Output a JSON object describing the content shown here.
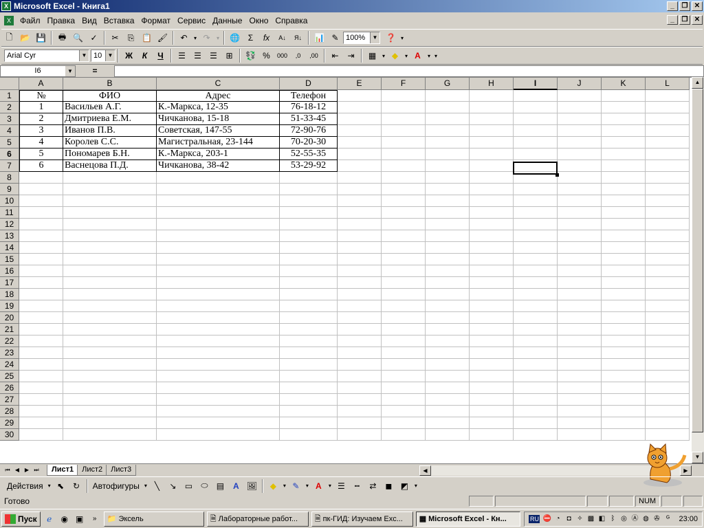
{
  "window": {
    "title": "Microsoft Excel - Книга1",
    "app_icon": "X"
  },
  "menu": [
    "Файл",
    "Правка",
    "Вид",
    "Вставка",
    "Формат",
    "Сервис",
    "Данные",
    "Окно",
    "Справка"
  ],
  "toolbar": {
    "zoom": "100%",
    "font_name": "Arial Cyr",
    "font_size": "10",
    "bold": "Ж",
    "italic": "К",
    "underline": "Ч"
  },
  "formula": {
    "name_box": "I6",
    "equals": "=",
    "value": ""
  },
  "columns": [
    "A",
    "B",
    "C",
    "D",
    "E",
    "F",
    "G",
    "H",
    "I",
    "J",
    "K",
    "L"
  ],
  "rows": [
    "1",
    "2",
    "3",
    "4",
    "5",
    "6",
    "7",
    "8",
    "9",
    "10",
    "11",
    "12",
    "13",
    "14",
    "15",
    "16",
    "17",
    "18",
    "19",
    "20",
    "21",
    "22",
    "23",
    "24",
    "25",
    "26",
    "27",
    "28",
    "29",
    "30"
  ],
  "table": {
    "headers": [
      "№",
      "ФИО",
      "Адрес",
      "Телефон"
    ],
    "data": [
      [
        "1",
        "Васильев А.Г.",
        "К.-Маркса, 12-35",
        "76-18-12"
      ],
      [
        "2",
        "Дмитриева Е.М.",
        "Чичканова, 15-18",
        "51-33-45"
      ],
      [
        "3",
        "Иванов П.В.",
        "Советская, 147-55",
        "72-90-76"
      ],
      [
        "4",
        "Королев С.С.",
        "Магистральная, 23-144",
        "70-20-30"
      ],
      [
        "5",
        "Пономарев Б.Н.",
        "К.-Маркса, 203-1",
        "52-55-35"
      ],
      [
        "6",
        "Васнецова П.Д.",
        "Чичканова, 38-42",
        "53-29-92"
      ]
    ]
  },
  "sheets": [
    "Лист1",
    "Лист2",
    "Лист3"
  ],
  "drawing": {
    "actions": "Действия",
    "autoshapes": "Автофигуры"
  },
  "status": {
    "text": "Готово",
    "num": "NUM"
  },
  "taskbar": {
    "start": "Пуск",
    "items": [
      "Эксель",
      "Лабораторные работ...",
      "пк-ГИД: Изучаем Exc...",
      "Microsoft Excel - Кн..."
    ],
    "lang": "RU",
    "clock": "23:00"
  }
}
